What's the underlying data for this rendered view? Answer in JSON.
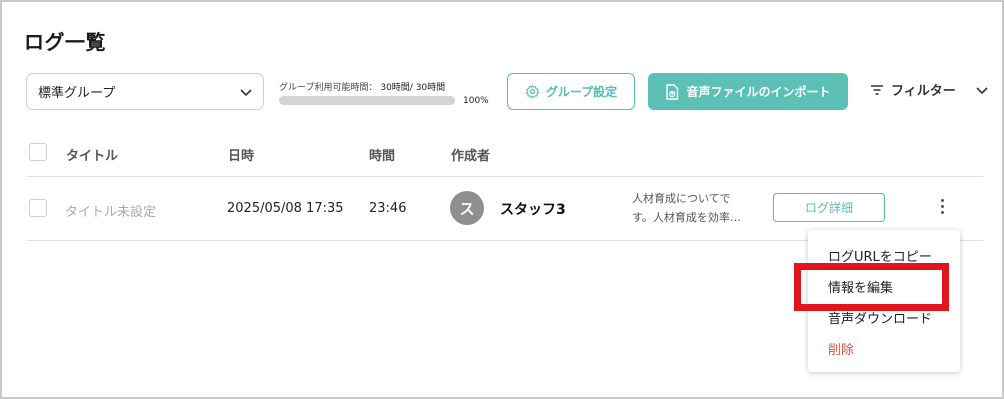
{
  "page": {
    "title": "ログ一覧"
  },
  "toolbar": {
    "group_select": {
      "value": "標準グループ"
    },
    "usage": {
      "label": "グループ利用可能時間：",
      "value": "30時間/ 30時間",
      "percent_label": "100%",
      "fill_fraction": 1.0
    },
    "group_settings_label": "グループ設定",
    "import_label": "音声ファイルのインポート",
    "filter_label": "フィルター"
  },
  "table": {
    "headers": {
      "title": "タイトル",
      "datetime": "日時",
      "duration": "時間",
      "creator": "作成者"
    },
    "rows": [
      {
        "title": "タイトル未設定",
        "datetime": "2025/05/08 17:35",
        "duration": "23:46",
        "avatar_initial": "ス",
        "creator": "スタッフ3",
        "summary_line1": "人材育成についてで",
        "summary_line2": "す。人材育成を効率…",
        "detail_label": "ログ詳細"
      }
    ]
  },
  "context_menu": {
    "items": [
      "ログURLをコピー",
      "情報を編集",
      "音声ダウンロード",
      "削除"
    ]
  },
  "colors": {
    "accent": "#5cc0b5",
    "danger": "#e0523f",
    "highlight": "#e0151d"
  }
}
